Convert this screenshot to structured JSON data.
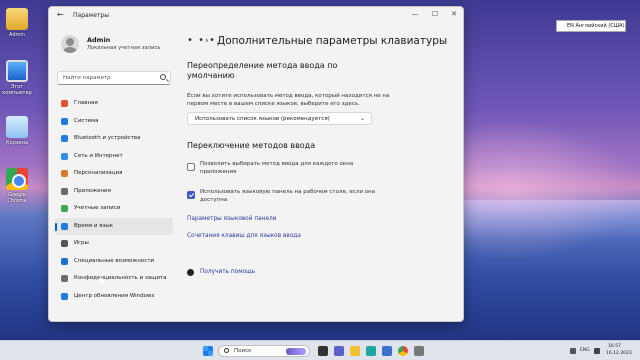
{
  "window": {
    "title": "Параметры",
    "back_glyph": "←",
    "minimize_glyph": "—",
    "maximize_glyph": "☐",
    "close_glyph": "✕"
  },
  "user": {
    "name": "Admin",
    "account_type": "Локальная учетная запись"
  },
  "search": {
    "placeholder": "Найти параметр"
  },
  "sidebar": {
    "items": [
      {
        "label": "Главная",
        "icon": "home-icon",
        "color": "#e0542d"
      },
      {
        "label": "Система",
        "icon": "system-icon",
        "color": "#1d7be2"
      },
      {
        "label": "Bluetooth и устройства",
        "icon": "bluetooth-icon",
        "color": "#1d7be2"
      },
      {
        "label": "Сеть и Интернет",
        "icon": "network-icon",
        "color": "#2c8de8"
      },
      {
        "label": "Персонализация",
        "icon": "personalization-icon",
        "color": "#d27c2b"
      },
      {
        "label": "Приложения",
        "icon": "apps-icon",
        "color": "#6b6b6b"
      },
      {
        "label": "Учетные записи",
        "icon": "accounts-icon",
        "color": "#3aa757"
      },
      {
        "label": "Время и язык",
        "icon": "time-language-icon",
        "color": "#1d7be2",
        "active": true
      },
      {
        "label": "Игры",
        "icon": "gaming-icon",
        "color": "#555555"
      },
      {
        "label": "Специальные возможности",
        "icon": "accessibility-icon",
        "color": "#1d6fd1"
      },
      {
        "label": "Конфиденциальность и защита",
        "icon": "privacy-icon",
        "color": "#6b6b6b"
      },
      {
        "label": "Центр обновления Windows",
        "icon": "update-icon",
        "color": "#1d7be2"
      }
    ]
  },
  "header": {
    "overflow": "• • •",
    "chevron": "›",
    "title": "Дополнительные параметры клавиатуры"
  },
  "override": {
    "heading": "Переопределение метода ввода по умолчанию",
    "heading_line1": "Переопределение метода ввода по",
    "heading_line2": "умолчанию",
    "desc_line1": "Если вы хотите использовать метод ввода, который находится не на",
    "desc_line2": "первом месте в вашем списке языков, выберите его здесь.",
    "dropdown_value": "Использовать список языков (рекомендуется)",
    "dropdown_chevron": "⌄"
  },
  "switching": {
    "heading": "Переключение методов ввода",
    "option1_line1": "Позволить выбирать метод ввода для каждого окна",
    "option1_line2": "приложения",
    "option1_checked": false,
    "option2_line1": "Использовать языковую панель на рабочем столе, если она",
    "option2_line2": "доступна",
    "option2_checked": true,
    "link_language_bar": "Параметры языковой панели",
    "link_hotkeys": "Сочетания клавиш для языков ввода"
  },
  "help": {
    "label": "Получить помощь"
  },
  "desktop": {
    "icons": [
      {
        "label": "Admin",
        "icon": "folder-icon"
      },
      {
        "label": "Этот компьютер",
        "icon": "computer-icon"
      },
      {
        "label": "Корзина",
        "icon": "recycle-bin-icon"
      },
      {
        "label": "Google Chrome",
        "icon": "chrome-icon"
      }
    ],
    "language_indicator": "EN Английский (США)"
  },
  "taskbar": {
    "search_label": "Поиск",
    "tray_lang": "ENG",
    "time": "16:57",
    "date": "16.12.2023"
  },
  "colors": {
    "accent": "#005fb8",
    "checkbox": "#3a57c2",
    "link": "#2a3aa0"
  }
}
